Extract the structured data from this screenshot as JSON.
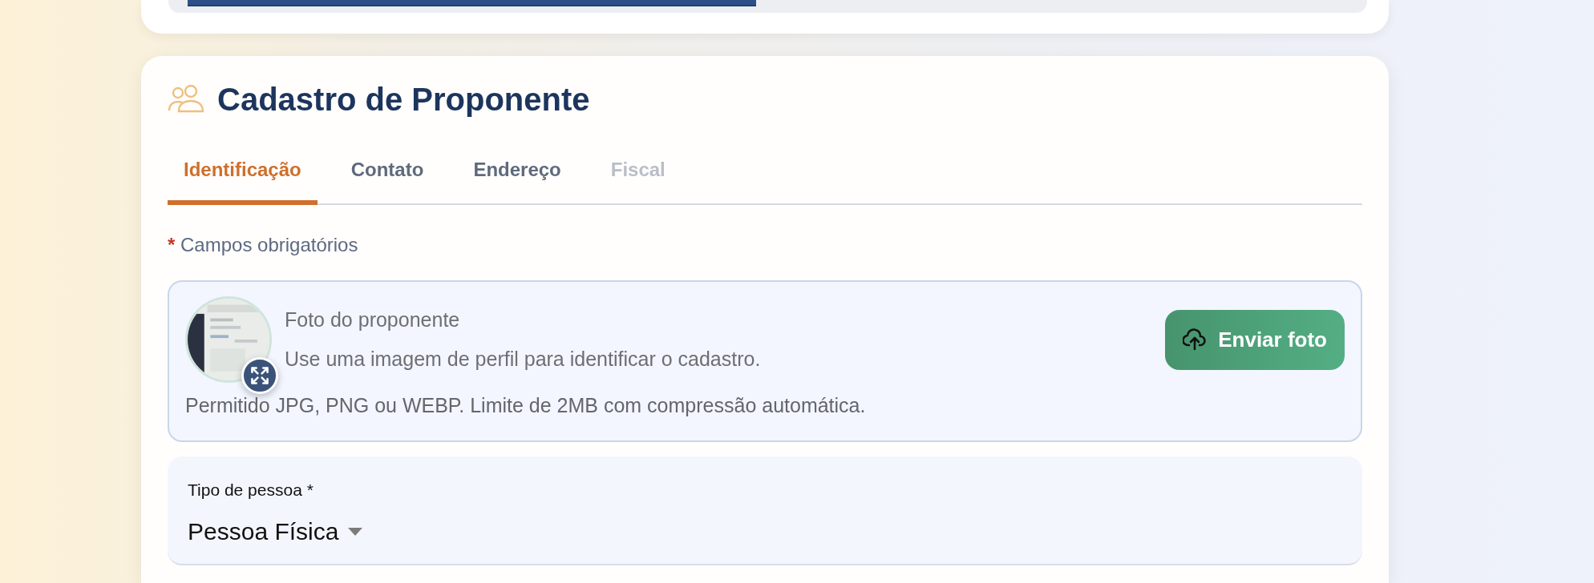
{
  "title": "Cadastro de Proponente",
  "tabs": [
    {
      "label": "Identificação",
      "selected": true,
      "disabled": false
    },
    {
      "label": "Contato",
      "selected": false,
      "disabled": false
    },
    {
      "label": "Endereço",
      "selected": false,
      "disabled": false
    },
    {
      "label": "Fiscal",
      "selected": false,
      "disabled": true
    }
  ],
  "required_note": {
    "mark": "*",
    "text": "Campos obrigatórios"
  },
  "photo": {
    "title": "Foto do proponente",
    "subtitle": "Use uma imagem de perfil para identificar o cadastro.",
    "hint": "Permitido JPG, PNG ou WEBP. Limite de 2MB com compressão automática.",
    "button": "Enviar foto"
  },
  "person_type": {
    "label": "Tipo de pessoa *",
    "value": "Pessoa Física"
  }
}
